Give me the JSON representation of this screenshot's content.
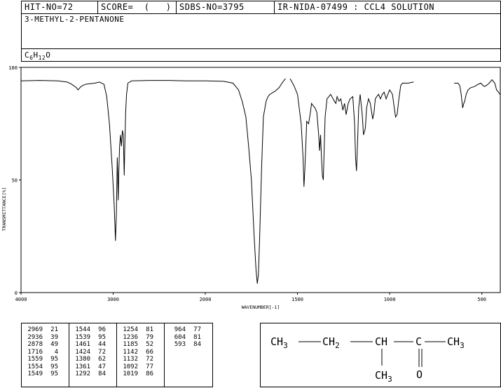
{
  "header": {
    "hit_no": "HIT-NO=72",
    "score": "SCORE=  (   )",
    "sdbs_no": "SDBS-NO=3795",
    "ir_id": "IR-NIDA-07499 : CCL4 SOLUTION"
  },
  "compound": {
    "name": "3-METHYL-2-PENTANONE",
    "formula_prefix": "C",
    "formula_c_sub": "6",
    "formula_h": "H",
    "formula_h_sub": "12",
    "formula_o": "O"
  },
  "chart_data": {
    "type": "line",
    "xlabel": "WAVENUMBER[-1]",
    "ylabel": "TRANSMITTANCE[%]",
    "xlim": [
      4000,
      400
    ],
    "ylim": [
      0,
      100
    ],
    "x_ticks": [
      4000,
      3000,
      2000,
      1500,
      1000,
      500
    ],
    "y_ticks": [
      0,
      50,
      100
    ],
    "grid": false,
    "series": [
      {
        "segment": 1,
        "points": [
          [
            4000,
            94
          ],
          [
            3800,
            94.2
          ],
          [
            3600,
            94
          ],
          [
            3500,
            93.5
          ],
          [
            3450,
            92.5
          ],
          [
            3400,
            91
          ],
          [
            3380,
            90
          ],
          [
            3350,
            91.5
          ],
          [
            3300,
            92.5
          ],
          [
            3200,
            93
          ],
          [
            3150,
            93.5
          ],
          [
            3100,
            92.5
          ],
          [
            3070,
            87
          ],
          [
            3040,
            75
          ],
          [
            3010,
            55
          ],
          [
            2990,
            40
          ],
          [
            2975,
            23
          ],
          [
            2965,
            35
          ],
          [
            2955,
            60
          ],
          [
            2950,
            52
          ],
          [
            2945,
            41
          ],
          [
            2938,
            55
          ],
          [
            2930,
            65
          ],
          [
            2920,
            70
          ],
          [
            2910,
            65
          ],
          [
            2900,
            72
          ],
          [
            2890,
            70
          ],
          [
            2880,
            52
          ],
          [
            2875,
            62
          ],
          [
            2865,
            80
          ],
          [
            2855,
            88
          ],
          [
            2840,
            93
          ],
          [
            2800,
            94
          ],
          [
            2600,
            94.2
          ],
          [
            2400,
            94.2
          ],
          [
            2200,
            94
          ],
          [
            2000,
            94
          ],
          [
            1900,
            93.8
          ],
          [
            1850,
            93
          ],
          [
            1820,
            90
          ],
          [
            1800,
            85
          ],
          [
            1780,
            78
          ],
          [
            1765,
            65
          ],
          [
            1750,
            50
          ],
          [
            1735,
            25
          ],
          [
            1725,
            10
          ],
          [
            1718,
            4
          ],
          [
            1712,
            8
          ],
          [
            1705,
            25
          ],
          [
            1695,
            55
          ],
          [
            1685,
            78
          ],
          [
            1670,
            85
          ],
          [
            1660,
            87
          ],
          [
            1650,
            88
          ],
          [
            1620,
            89.5
          ],
          [
            1600,
            91
          ],
          [
            1580,
            93.5
          ],
          [
            1565,
            95
          ]
        ]
      },
      {
        "segment": 2,
        "points": [
          [
            1540,
            95
          ],
          [
            1520,
            92
          ],
          [
            1500,
            88
          ],
          [
            1480,
            75
          ],
          [
            1470,
            60
          ],
          [
            1465,
            47
          ],
          [
            1460,
            55
          ],
          [
            1455,
            65
          ],
          [
            1450,
            76
          ],
          [
            1440,
            75
          ],
          [
            1430,
            80
          ],
          [
            1424,
            84
          ],
          [
            1415,
            83
          ],
          [
            1405,
            82
          ],
          [
            1395,
            80
          ],
          [
            1385,
            70
          ],
          [
            1380,
            63
          ],
          [
            1375,
            70
          ],
          [
            1370,
            60
          ],
          [
            1365,
            52
          ],
          [
            1360,
            50
          ],
          [
            1356,
            62
          ],
          [
            1350,
            78
          ],
          [
            1340,
            86
          ],
          [
            1330,
            87
          ],
          [
            1320,
            88
          ],
          [
            1300,
            85
          ],
          [
            1292,
            84
          ],
          [
            1285,
            87
          ],
          [
            1275,
            85
          ],
          [
            1265,
            86
          ],
          [
            1254,
            81
          ],
          [
            1245,
            84
          ],
          [
            1236,
            79
          ],
          [
            1225,
            84
          ],
          [
            1215,
            86
          ],
          [
            1200,
            87
          ],
          [
            1190,
            75
          ],
          [
            1185,
            60
          ],
          [
            1180,
            54
          ],
          [
            1175,
            65
          ],
          [
            1168,
            82
          ],
          [
            1160,
            88
          ],
          [
            1150,
            80
          ],
          [
            1142,
            70
          ],
          [
            1135,
            72
          ],
          [
            1132,
            73
          ],
          [
            1125,
            82
          ],
          [
            1115,
            86
          ],
          [
            1105,
            84
          ],
          [
            1092,
            77
          ],
          [
            1085,
            80
          ],
          [
            1078,
            86
          ],
          [
            1070,
            87
          ],
          [
            1060,
            88
          ],
          [
            1050,
            86
          ],
          [
            1040,
            88
          ],
          [
            1030,
            89
          ],
          [
            1019,
            86
          ],
          [
            1010,
            88
          ],
          [
            1000,
            90
          ],
          [
            985,
            88
          ],
          [
            975,
            82
          ],
          [
            968,
            78
          ],
          [
            960,
            79
          ],
          [
            950,
            86
          ],
          [
            940,
            92
          ],
          [
            930,
            93
          ],
          [
            900,
            93
          ],
          [
            870,
            93.5
          ]
        ]
      },
      {
        "segment": 3,
        "points": [
          [
            650,
            93
          ],
          [
            630,
            93
          ],
          [
            620,
            92
          ],
          [
            612,
            88
          ],
          [
            604,
            82
          ],
          [
            598,
            84
          ],
          [
            593,
            85
          ],
          [
            585,
            88
          ],
          [
            575,
            90
          ],
          [
            560,
            91
          ],
          [
            540,
            91.5
          ],
          [
            520,
            92.5
          ],
          [
            505,
            93
          ],
          [
            495,
            92
          ],
          [
            485,
            91.5
          ],
          [
            475,
            92
          ],
          [
            460,
            93
          ],
          [
            445,
            94.5
          ],
          [
            430,
            93
          ],
          [
            420,
            90
          ],
          [
            410,
            89
          ],
          [
            402,
            88
          ]
        ]
      }
    ]
  },
  "peak_table": {
    "columns": [
      [
        [
          "2969",
          "21"
        ],
        [
          "2936",
          "39"
        ],
        [
          "2878",
          "49"
        ],
        [
          "1716",
          "4"
        ],
        [
          "1559",
          "95"
        ],
        [
          "1554",
          "95"
        ],
        [
          "1549",
          "95"
        ]
      ],
      [
        [
          "1544",
          "96"
        ],
        [
          "1539",
          "95"
        ],
        [
          "1461",
          "44"
        ],
        [
          "1424",
          "72"
        ],
        [
          "1380",
          "62"
        ],
        [
          "1361",
          "47"
        ],
        [
          "1292",
          "84"
        ]
      ],
      [
        [
          "1254",
          "81"
        ],
        [
          "1236",
          "79"
        ],
        [
          "1185",
          "52"
        ],
        [
          "1142",
          "66"
        ],
        [
          "1132",
          "72"
        ],
        [
          "1092",
          "77"
        ],
        [
          "1019",
          "86"
        ]
      ],
      [
        [
          "964",
          "77"
        ],
        [
          "604",
          "81"
        ],
        [
          "593",
          "84"
        ]
      ]
    ]
  },
  "structure": {
    "ch3_left": "CH",
    "sub3_left": "3",
    "ch2": "CH",
    "sub2": "2",
    "ch": "CH",
    "c": "C",
    "ch3_right": "CH",
    "sub3_right": "3",
    "ch3_bottom": "CH",
    "sub3_bottom": "3",
    "o": "O"
  }
}
